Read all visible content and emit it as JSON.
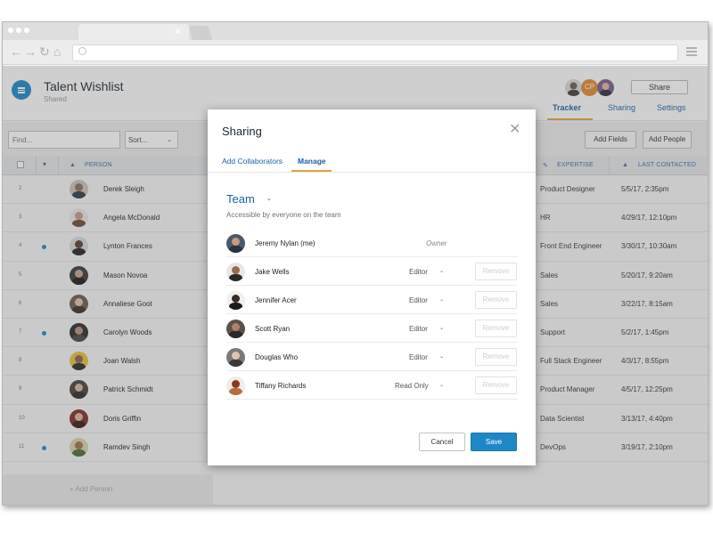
{
  "app": {
    "title": "Talent Wishlist",
    "subtitle": "Shared",
    "share_label": "Share",
    "cp_initials": "CP",
    "tabs": [
      {
        "label": "Tracker",
        "active": true
      },
      {
        "label": "Sharing",
        "active": false
      },
      {
        "label": "Settings",
        "active": false
      }
    ]
  },
  "filters": {
    "find_placeholder": "Find...",
    "sort_label": "Sort...",
    "add_fields_label": "Add Fields",
    "add_people_label": "Add People"
  },
  "table": {
    "headers": {
      "person": "PERSON",
      "expertise": "EXPERTISE",
      "last_contacted": "LAST CONTACTED"
    },
    "rows": [
      {
        "num": "2",
        "dot": false,
        "name": "Derek Sleigh",
        "expertise": "Product Designer",
        "last": "5/5/17, 2:35pm"
      },
      {
        "num": "3",
        "dot": false,
        "name": "Angela McDonald",
        "expertise": "HR",
        "last": "4/29/17, 12:10pm"
      },
      {
        "num": "4",
        "dot": true,
        "name": "Lynton Frances",
        "expertise": "Front End Engineer",
        "last": "3/30/17, 10:30am"
      },
      {
        "num": "5",
        "dot": false,
        "name": "Mason Novoa",
        "expertise": "Sales",
        "last": "5/20/17, 9:20am"
      },
      {
        "num": "6",
        "dot": false,
        "name": "Annaliese Goot",
        "expertise": "Sales",
        "last": "3/22/17, 8:15am"
      },
      {
        "num": "7",
        "dot": true,
        "name": "Carolyn Woods",
        "expertise": "Support",
        "last": "5/2/17, 1:45pm"
      },
      {
        "num": "8",
        "dot": false,
        "name": "Joan Walsh",
        "expertise": "Full Stack Engineer",
        "last": "4/3/17, 8:55pm"
      },
      {
        "num": "9",
        "dot": false,
        "name": "Patrick Schmidt",
        "expertise": "Product Manager",
        "last": "4/5/17, 12:25pm"
      },
      {
        "num": "10",
        "dot": false,
        "name": "Doris Griffin",
        "expertise": "Data Scientist",
        "last": "3/13/17, 4:40pm"
      },
      {
        "num": "11",
        "dot": true,
        "name": "Ramdev Singh",
        "expertise": "DevOps",
        "last": "3/19/17, 2:10pm"
      }
    ],
    "add_person_label": "+ Add Person"
  },
  "modal": {
    "title": "Sharing",
    "tabs": [
      {
        "label": "Add Collaborators",
        "active": false
      },
      {
        "label": "Manage",
        "active": true
      }
    ],
    "team_title": "Team",
    "team_desc": "Accessible by everyone on the team",
    "members": [
      {
        "name": "Jeremy Nylan (me)",
        "role": "Owner",
        "remove": ""
      },
      {
        "name": "Jake Wells",
        "role": "Editor",
        "remove": "Remove"
      },
      {
        "name": "Jennifer Acer",
        "role": "Editor",
        "remove": "Remove"
      },
      {
        "name": "Scott Ryan",
        "role": "Editor",
        "remove": "Remove"
      },
      {
        "name": "Douglas Who",
        "role": "Editor",
        "remove": "Remove"
      },
      {
        "name": "Tiffany Richards",
        "role": "Read Only",
        "remove": "Remove"
      }
    ],
    "cancel_label": "Cancel",
    "save_label": "Save"
  },
  "colors": {
    "accent": "#1e88c7",
    "tab_underline": "#e5a14a",
    "link": "#1e5fa5"
  }
}
